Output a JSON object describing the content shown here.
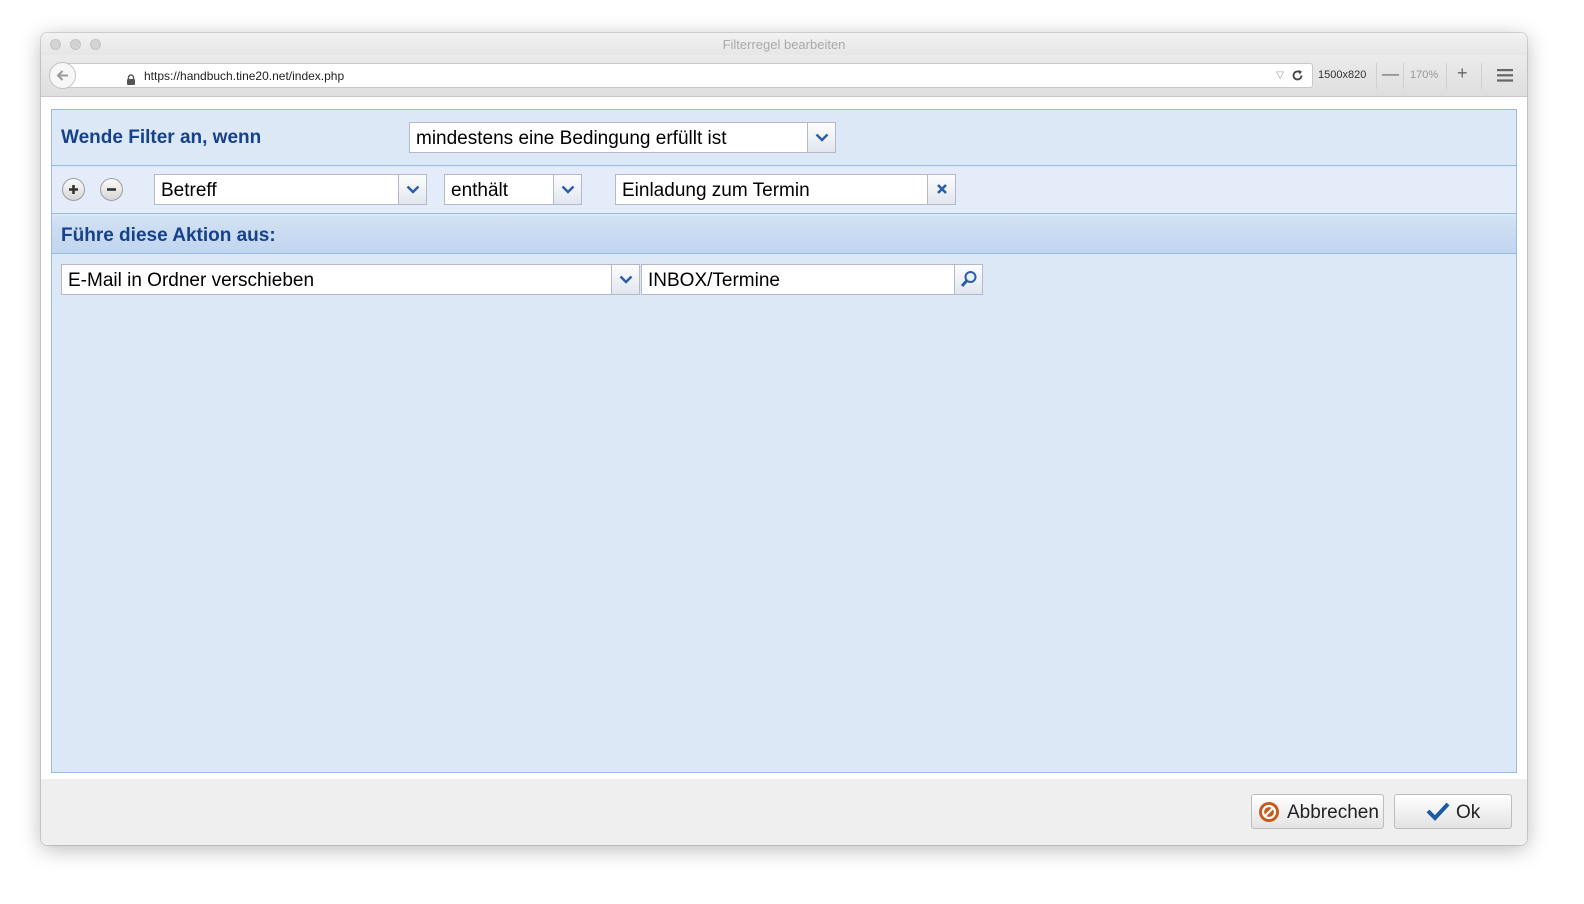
{
  "window": {
    "title": "Filterregel bearbeiten"
  },
  "browser": {
    "url": "https://handbuch.tine20.net/index.php",
    "viewport_size": "1500x820",
    "zoom_level": "170%",
    "zoom_minus": "—",
    "zoom_plus": "+"
  },
  "filter": {
    "apply_label": "Wende Filter an, wenn",
    "match_mode": "mindestens eine Bedingung erfüllt ist",
    "condition": {
      "field": "Betreff",
      "operator": "enthält",
      "value": "Einladung zum Termin"
    }
  },
  "action": {
    "section_title": "Führe diese Aktion aus:",
    "type": "E-Mail in Ordner verschieben",
    "target": "INBOX/Termine"
  },
  "footer": {
    "cancel_label": "Abbrechen",
    "ok_label": "Ok"
  },
  "colors": {
    "panel_bg": "#dde8f6",
    "border": "#99bbe8",
    "label": "#15428b",
    "cancel_icon": "#c65a1b",
    "ok_icon": "#1a5ba6"
  }
}
